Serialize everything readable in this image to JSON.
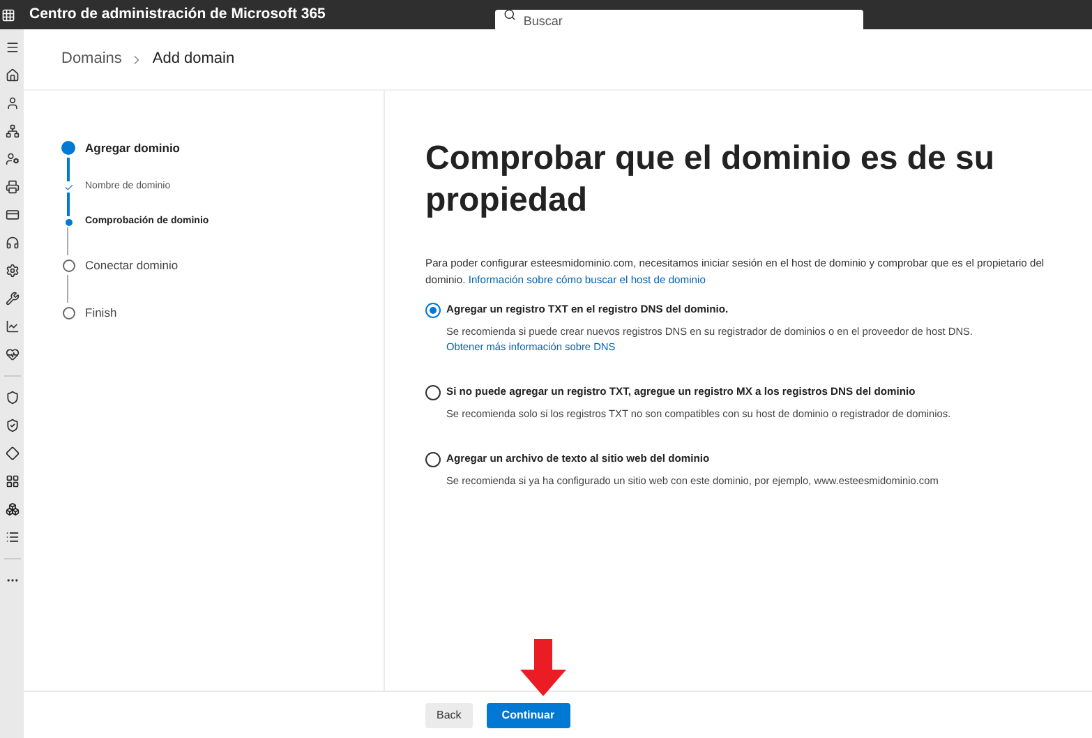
{
  "header": {
    "title": "Centro de administración de Microsoft 365",
    "search": {
      "placeholder": "Buscar"
    }
  },
  "breadcrumb": [
    {
      "label": "Domains",
      "current": false
    },
    {
      "label": "Add domain",
      "current": true
    }
  ],
  "steps": [
    {
      "label": "Agregar dominio",
      "current": true,
      "done": false,
      "children": [
        {
          "label": "Nombre de dominio",
          "current": false,
          "done": true
        },
        {
          "label": "Comprobación de dominio",
          "current": true,
          "done": false
        }
      ]
    },
    {
      "label": "Conectar dominio",
      "current": false,
      "done": false
    },
    {
      "label": "Finish",
      "current": false,
      "done": false
    }
  ],
  "title": "Comprobar que el dominio es de su propiedad",
  "intro": {
    "text": "Para poder configurar esteesmidominio.com, necesitamos iniciar sesión en el host de dominio y comprobar que es el propietario del dominio.",
    "link": "Información sobre cómo buscar el host de dominio"
  },
  "options": [
    {
      "label": "Agregar un registro TXT en el registro DNS del dominio.",
      "description": "Se recomienda si puede crear nuevos registros DNS en su registrador de dominios o en el proveedor de host DNS.",
      "link": "Obtener más información sobre DNS",
      "selected": true
    },
    {
      "label": "Si no puede agregar un registro TXT, agregue un registro MX a los registros DNS del dominio",
      "description": "Se recomienda solo si los registros TXT no son compatibles con su host de dominio o registrador de dominios.",
      "selected": false
    },
    {
      "label": "Agregar un archivo de texto al sitio web del dominio",
      "description": "Se recomienda si ya ha configurado un sitio web con este dominio, por ejemplo, www.esteesmidominio.com",
      "selected": false
    }
  ],
  "buttons": [
    {
      "label": "Back",
      "kind": "secondary"
    },
    {
      "label": "Continuar",
      "kind": "primary"
    }
  ]
}
